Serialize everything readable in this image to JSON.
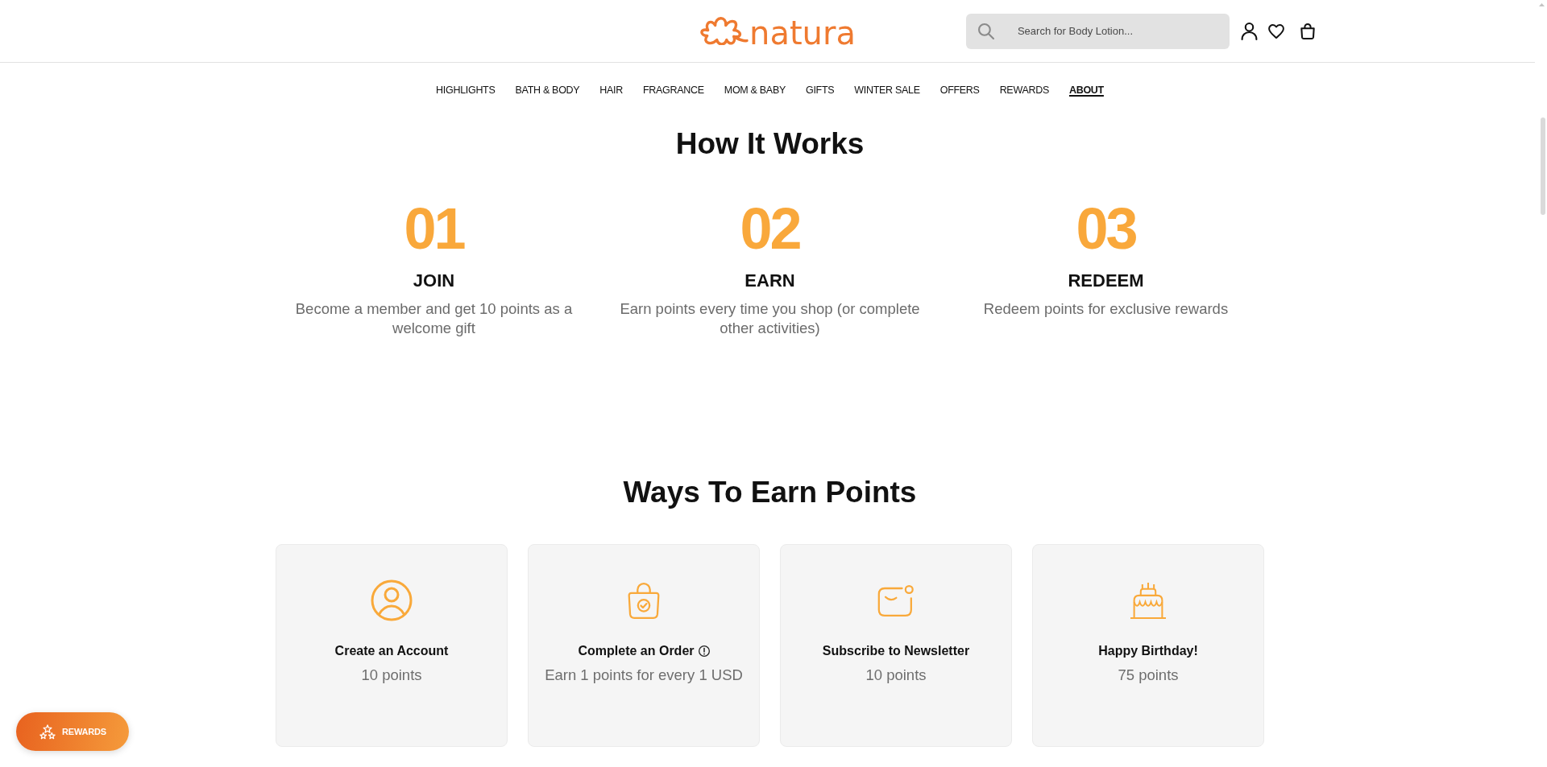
{
  "header": {
    "logo": "natura",
    "search": {
      "placeholder": "Search for Body Lotion..."
    }
  },
  "nav": [
    {
      "label": "HIGHLIGHTS",
      "selected": false
    },
    {
      "label": "BATH & BODY",
      "selected": false
    },
    {
      "label": "HAIR",
      "selected": false
    },
    {
      "label": "FRAGRANCE",
      "selected": false
    },
    {
      "label": "MOM & BABY",
      "selected": false
    },
    {
      "label": "GIFTS",
      "selected": false
    },
    {
      "label": "WINTER SALE",
      "selected": false
    },
    {
      "label": "OFFERS",
      "selected": false
    },
    {
      "label": "REWARDS",
      "selected": false
    },
    {
      "label": "ABOUT",
      "selected": true
    }
  ],
  "how_it_works": {
    "title": "How It Works",
    "steps": [
      {
        "number": "01",
        "title": "JOIN",
        "description": "Become a member and get 10 points as a welcome gift"
      },
      {
        "number": "02",
        "title": "EARN",
        "description": "Earn points every time you shop (or complete other activities)"
      },
      {
        "number": "03",
        "title": "REDEEM",
        "description": "Redeem points for exclusive rewards"
      }
    ]
  },
  "ways_to_earn": {
    "title": "Ways To Earn Points",
    "cards": [
      {
        "kind": "account",
        "title": "Create an Account",
        "info": false,
        "points": "10 points"
      },
      {
        "kind": "order",
        "title": "Complete an Order",
        "info": true,
        "points": "Earn 1 points for every 1 USD"
      },
      {
        "kind": "newsletter",
        "title": "Subscribe to Newsletter",
        "info": false,
        "points": "10 points"
      },
      {
        "kind": "birthday",
        "title": "Happy Birthday!",
        "info": false,
        "points": "75 points"
      }
    ]
  },
  "rewards_launcher": {
    "label": "REWARDS"
  }
}
